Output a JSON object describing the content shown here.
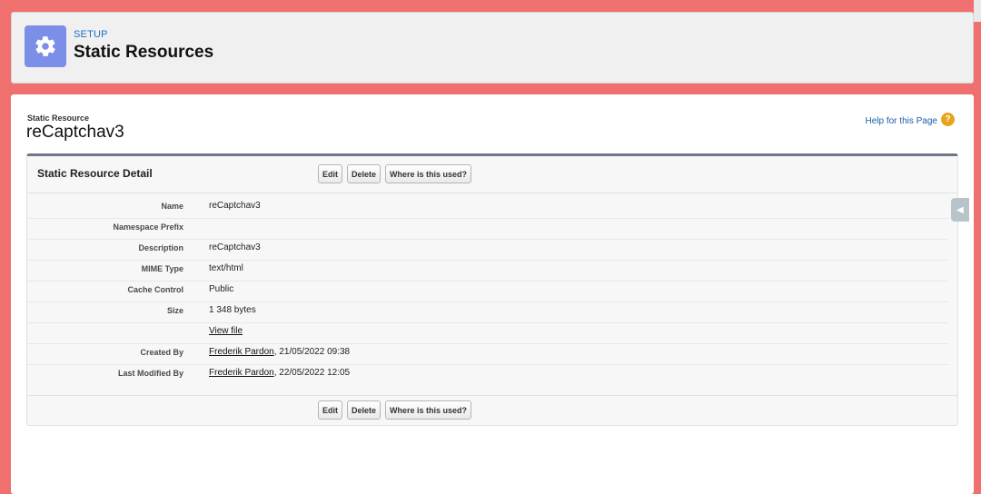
{
  "header": {
    "setup_label": "SETUP",
    "title": "Static Resources",
    "icon": "gear-icon",
    "icon_color": "#7b8fe8"
  },
  "record": {
    "type_label": "Static Resource",
    "title": "reCaptchav3",
    "help_link": "Help for this Page",
    "help_icon": "?"
  },
  "detail": {
    "title": "Static Resource Detail",
    "buttons": {
      "edit": "Edit",
      "delete": "Delete",
      "where_used": "Where is this used?"
    },
    "fields": [
      {
        "label": "Name",
        "value": "reCaptchav3"
      },
      {
        "label": "Namespace Prefix",
        "value": ""
      },
      {
        "label": "Description",
        "value": "reCaptchav3"
      },
      {
        "label": "MIME Type",
        "value": "text/html"
      },
      {
        "label": "Cache Control",
        "value": "Public"
      },
      {
        "label": "Size",
        "value": "1 348 bytes"
      },
      {
        "label": "",
        "value": "View file"
      },
      {
        "label": "Created By",
        "user": "Frederik Pardon",
        "date": ", 21/05/2022 09:38"
      },
      {
        "label": "Last Modified By",
        "user": "Frederik Pardon",
        "date": ", 22/05/2022 12:05"
      }
    ]
  },
  "colors": {
    "background": "#f07070",
    "accent_link": "#1a6fc7",
    "help_icon": "#e9a31c"
  }
}
